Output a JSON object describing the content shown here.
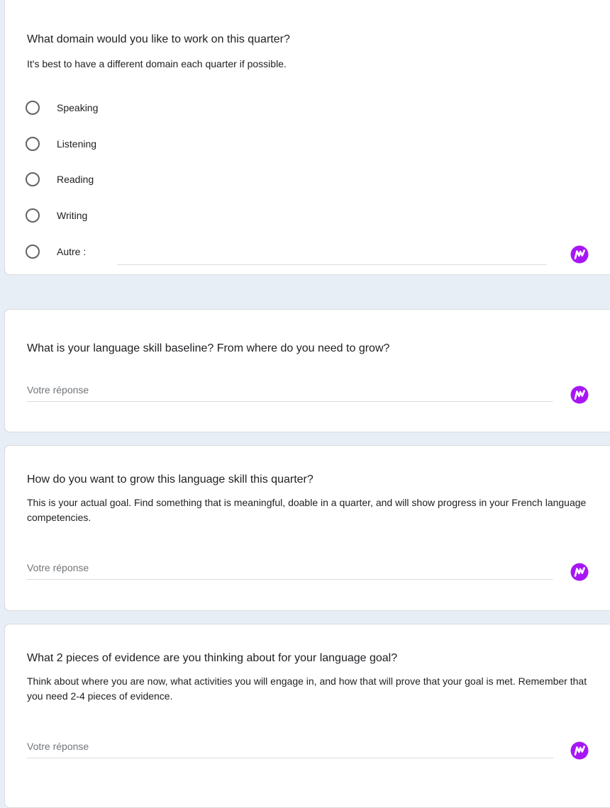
{
  "questions": [
    {
      "title": "What domain would you like to work on this quarter?",
      "description": "It's best to have a different domain each quarter if possible.",
      "options": [
        "Speaking",
        "Listening",
        "Reading",
        "Writing"
      ],
      "other_label": "Autre :"
    },
    {
      "title": "What is your language skill baseline? From where do you need to grow?",
      "placeholder": "Votre réponse"
    },
    {
      "title": "How do you want to grow this language skill this quarter?",
      "description": "This is your actual goal. Find something that is meaningful, doable in a quarter, and will show progress in your French language competencies.",
      "placeholder": "Votre réponse"
    },
    {
      "title": "What 2 pieces of evidence are you thinking about for your language goal?",
      "description": "Think about where you are now, what activities you will engage in, and how that will prove that your goal is met. Remember that you need 2-4 pieces of evidence.",
      "placeholder": "Votre réponse"
    }
  ],
  "colors": {
    "extension_icon": "#a716f5",
    "page_background": "#e8eef5",
    "card_background": "#ffffff"
  },
  "icons": {
    "extension": "extension-m-icon"
  }
}
